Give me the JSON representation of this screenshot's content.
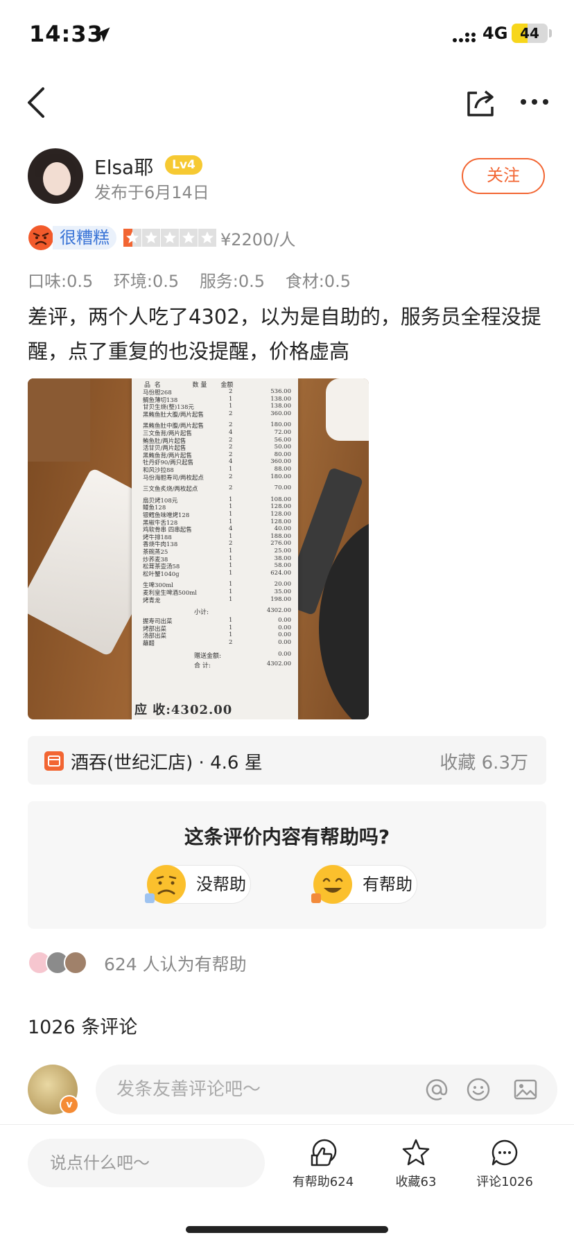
{
  "status_bar": {
    "time": "14:33",
    "network": "4G",
    "battery": "44",
    "battery_fraction": 0.44
  },
  "review": {
    "author": "Elsa耶",
    "level": "Lv4",
    "date": "发布于6月14日",
    "follow_label": "关注",
    "mood": "很糟糕",
    "rating_stars": 0.5,
    "price": "¥2200/人",
    "sub_scores": [
      "口味:0.5",
      "环境:0.5",
      "服务:0.5",
      "食材:0.5"
    ],
    "text": "差评，两个人吃了4302，以为是自助的，服务员全程没提醒，点了重复的也没提醒，价格虚高"
  },
  "receipt": {
    "header": "品  名                数 量       金额",
    "items": [
      {
        "name": "马份胆268",
        "qty": "2",
        "amt": "536.00"
      },
      {
        "name": "鲷鱼薄切138",
        "qty": "1",
        "amt": "138.00"
      },
      {
        "name": "甘贝生烧(整)138元",
        "qty": "1",
        "amt": "138.00"
      },
      {
        "name": "黑鲔鱼肚大腹/两片起售",
        "qty": "2",
        "amt": "360.00"
      },
      {
        "name": "黑鲔鱼肚中腹/两片起售",
        "qty": "2",
        "amt": "180.00"
      },
      {
        "name": "三文鱼背/两片起售",
        "qty": "4",
        "amt": "72.00"
      },
      {
        "name": "鲔鱼肚/两片起售",
        "qty": "2",
        "amt": "56.00"
      },
      {
        "name": "活甘贝/两片起售",
        "qty": "2",
        "amt": "50.00"
      },
      {
        "name": "黑鲔鱼背/两片起售",
        "qty": "2",
        "amt": "80.00"
      },
      {
        "name": "牡丹虾90/两只起售",
        "qty": "4",
        "amt": "360.00"
      },
      {
        "name": "和风沙拉88",
        "qty": "1",
        "amt": "88.00"
      },
      {
        "name": "马份海胆寿司/两枚起点",
        "qty": "2",
        "amt": "180.00"
      },
      {
        "name": "三文鱼炙烧/两枚起点",
        "qty": "2",
        "amt": "70.00"
      },
      {
        "name": "扇贝烤108元",
        "qty": "1",
        "amt": "108.00"
      },
      {
        "name": "鳗鱼128",
        "qty": "1",
        "amt": "128.00"
      },
      {
        "name": "银鳕鱼味噌烤128",
        "qty": "1",
        "amt": "128.00"
      },
      {
        "name": "黑椒牛舌128",
        "qty": "1",
        "amt": "128.00"
      },
      {
        "name": "鸡软骨串 四串起售",
        "qty": "4",
        "amt": "40.00"
      },
      {
        "name": "烤牛排188",
        "qty": "1",
        "amt": "188.00"
      },
      {
        "name": "香烧牛肉138",
        "qty": "2",
        "amt": "276.00"
      },
      {
        "name": "茶碗蒸25",
        "qty": "1",
        "amt": "25.00"
      },
      {
        "name": "炒荞麦38",
        "qty": "1",
        "amt": "38.00"
      },
      {
        "name": "松茸茶壶汤58",
        "qty": "1",
        "amt": "58.00"
      },
      {
        "name": "松叶蟹1040g",
        "qty": "1",
        "amt": "624.00"
      },
      {
        "name": "生啤300ml",
        "qty": "1",
        "amt": "20.00"
      },
      {
        "name": "麦利皇生啤酒500ml",
        "qty": "1",
        "amt": "35.00"
      },
      {
        "name": "烤青龙",
        "qty": "1",
        "amt": "198.00"
      }
    ],
    "subtotal_label": "小计:",
    "subtotal": "4302.00",
    "extras": [
      {
        "name": "握寿司出菜",
        "qty": "1",
        "amt": "0.00"
      },
      {
        "name": "烤部出菜",
        "qty": "1",
        "amt": "0.00"
      },
      {
        "name": "汤部出菜",
        "qty": "1",
        "amt": "0.00"
      },
      {
        "name": "蘸醋",
        "qty": "2",
        "amt": "0.00"
      }
    ],
    "gift_label": "赠送金额:",
    "gift": "0.00",
    "total_label": "合  计:",
    "total": "4302.00",
    "due": "应  收:4302.00"
  },
  "shop": {
    "name": "酒吞(世纪汇店) · 4.6 星",
    "favorites": "收藏 6.3万"
  },
  "helpful_prompt": {
    "question": "这条评价内容有帮助吗?",
    "not_helpful": "没帮助",
    "helpful": "有帮助"
  },
  "helpful_count": "624 人认为有帮助",
  "comments": {
    "count_label": "1026 条评论",
    "placeholder": "发条友善评论吧～",
    "badge": "v"
  },
  "bottom_bar": {
    "say_placeholder": "说点什么吧～",
    "helpful": "有帮助624",
    "favorite": "收藏63",
    "comment": "评论1026"
  },
  "colors": {
    "accent": "#f26532",
    "mood_blue": "#3a74d6",
    "level_gold": "#f6c932"
  },
  "icons": [
    "back-icon",
    "share-icon",
    "more-icon",
    "angry-face-icon",
    "star-icon",
    "shop-icon",
    "at-icon",
    "emoji-icon",
    "image-icon",
    "thumbs-up-icon",
    "favorite-star-icon",
    "comment-icon"
  ]
}
